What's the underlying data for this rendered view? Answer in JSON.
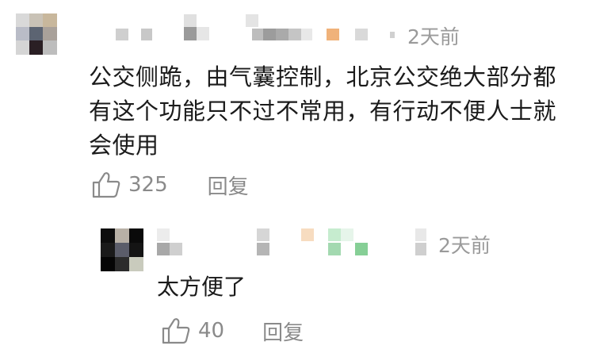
{
  "comment": {
    "timestamp": "2天前",
    "text": "公交侧跪，由气囊控制，北京公交绝大部分都有这个功能只不过不常用，有行动不便人士就会使用",
    "likes": "325",
    "reply_label": "回复"
  },
  "reply": {
    "timestamp": "2天前",
    "text": "太方便了",
    "likes": "40",
    "reply_label": "回复"
  },
  "colors": {
    "text": "#1b1b1b",
    "meta": "#8a8a8a",
    "timestamp": "#9a9a9a"
  },
  "icons": [
    "thumbs-up-icon"
  ]
}
